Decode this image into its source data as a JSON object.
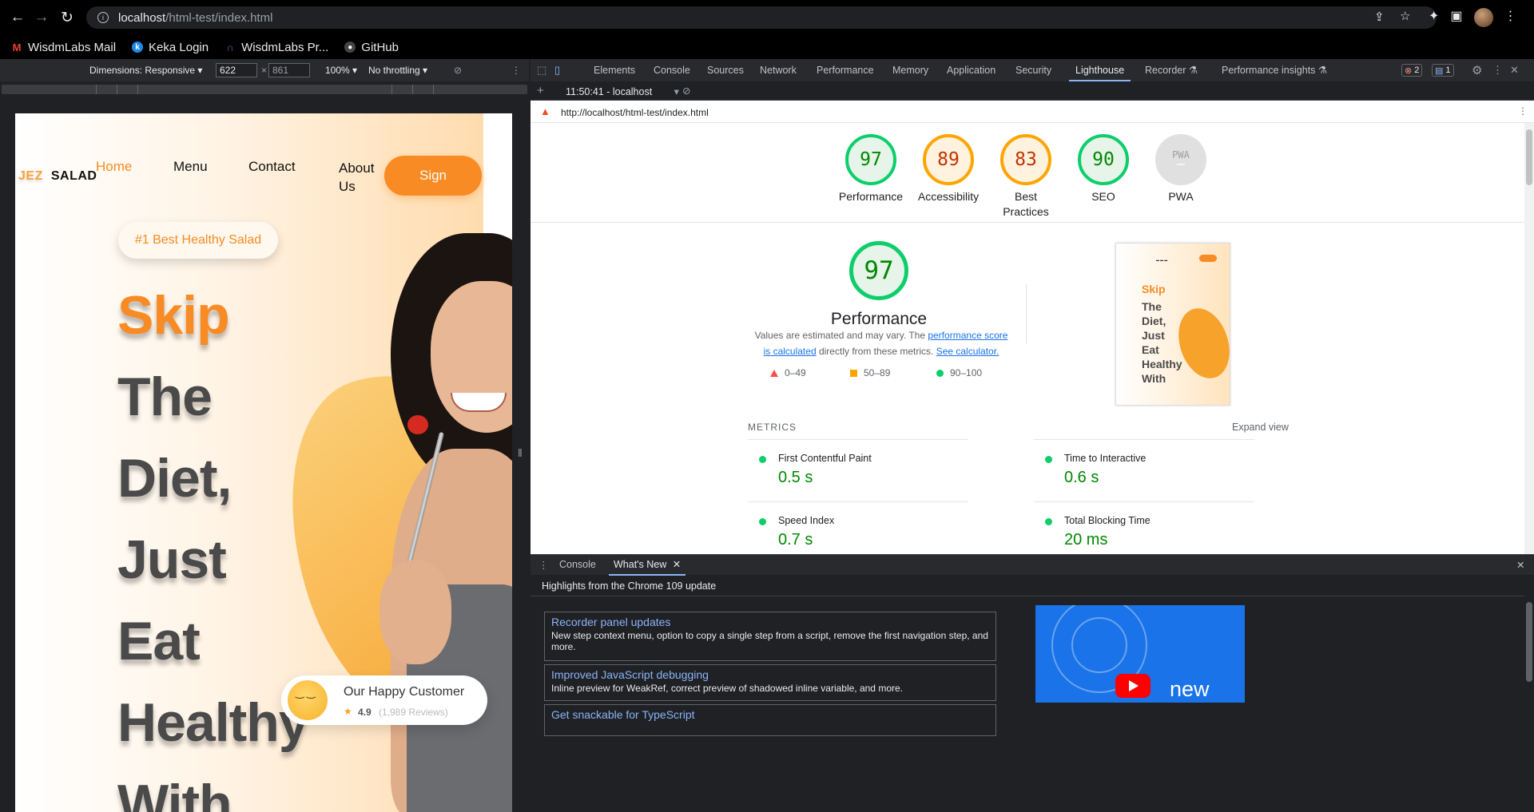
{
  "browser": {
    "url_host": "localhost",
    "url_path": "/html-test/index.html",
    "bookmarks": [
      {
        "label": "WisdmLabs Mail",
        "icon": "gmail-icon",
        "color": "#ea4335"
      },
      {
        "label": "Keka Login",
        "icon": "keka-icon",
        "color": "#1e88e5"
      },
      {
        "label": "WisdmLabs Pr...",
        "icon": "wisdmlabs-icon",
        "color": "#7e57c2"
      },
      {
        "label": "GitHub",
        "icon": "github-icon",
        "color": "#24292e"
      }
    ]
  },
  "device_toolbar": {
    "dimensions_label": "Dimensions: Responsive",
    "width": "622",
    "height": "861",
    "zoom": "100%",
    "throttling": "No throttling"
  },
  "site": {
    "logo_part1": "JEZ",
    "logo_part2": "SALAD",
    "nav": [
      "Home",
      "Menu",
      "Contact",
      "About",
      "Us"
    ],
    "sign_label": "Sign",
    "badge": "#1 Best Healthy Salad",
    "hero_lines": [
      "Skip",
      "The",
      "Diet,",
      "Just",
      "Eat",
      "Healthy",
      "With"
    ],
    "customer_title": "Our Happy Customer",
    "customer_rating": "4.9",
    "customer_reviews": "(1,989 Reviews)"
  },
  "devtools": {
    "tabs": [
      "Elements",
      "Console",
      "Sources",
      "Network",
      "Performance",
      "Memory",
      "Application",
      "Security",
      "Lighthouse",
      "Recorder",
      "Performance insights"
    ],
    "active_tab": "Lighthouse",
    "error_count": "2",
    "message_count": "1",
    "report_select": "11:50:41 - localhost",
    "report_url": "http://localhost/html-test/index.html"
  },
  "lighthouse": {
    "categories": [
      {
        "label": "Performance",
        "score": "97"
      },
      {
        "label": "Accessibility",
        "score": "89"
      },
      {
        "label": "Best",
        "label2": "Practices",
        "score": "83"
      },
      {
        "label": "SEO",
        "score": "90"
      },
      {
        "label": "PWA",
        "score": "PWA"
      }
    ],
    "perf_score": "97",
    "perf_title": "Performance",
    "perf_desc_1": "Values are estimated and may vary. The",
    "perf_desc_link1a": "performance score",
    "perf_desc_link1b": "is calculated",
    "perf_desc_2": "directly from these metrics.",
    "perf_desc_link2": "See calculator.",
    "legend": [
      "0–49",
      "50–89",
      "90–100"
    ],
    "metrics_heading": "METRICS",
    "expand_view": "Expand view",
    "metrics": [
      {
        "name": "First Contentful Paint",
        "value": "0.5 s"
      },
      {
        "name": "Time to Interactive",
        "value": "0.6 s"
      },
      {
        "name": "Speed Index",
        "value": "0.7 s"
      },
      {
        "name": "Total Blocking Time",
        "value": "20 ms"
      }
    ],
    "thumb_lines": [
      "Skip",
      "The",
      "Diet,",
      "Just",
      "Eat",
      "Healthy",
      "With"
    ]
  },
  "drawer": {
    "tabs": [
      "Console",
      "What's New"
    ],
    "heading": "Highlights from the Chrome 109 update",
    "news": [
      {
        "title": "Recorder panel updates",
        "desc": "New step context menu, option to copy a single step from a script, remove the first navigation step, and more."
      },
      {
        "title": "Improved JavaScript debugging",
        "desc": "Inline preview for WeakRef, correct preview of shadowed inline variable, and more."
      },
      {
        "title": "Get snackable for TypeScript",
        "desc": ""
      }
    ],
    "video_label": "new"
  }
}
